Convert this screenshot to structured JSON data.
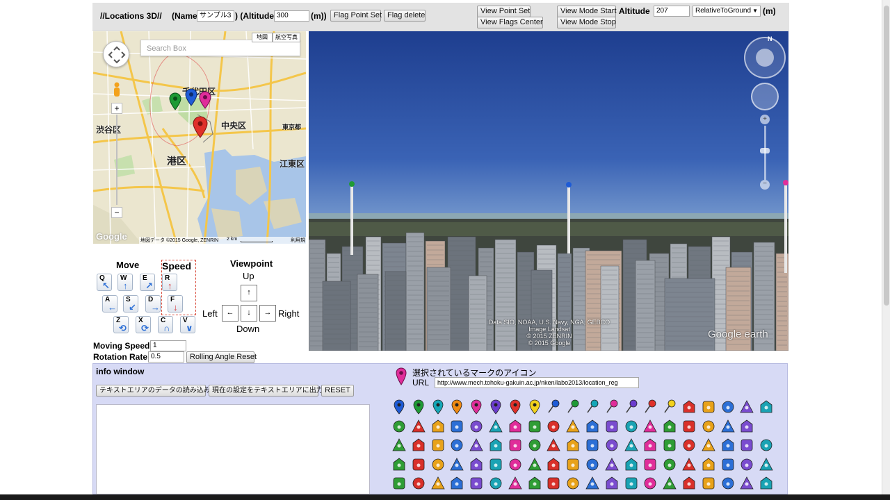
{
  "toolbar": {
    "title": "//Locations 3D//",
    "name_label": "(Name",
    "name_value": "サンプル3",
    "altitude_label": ") (Altitude",
    "altitude_value": "300",
    "altitude_unit": "(m))",
    "flag_point_set": "Flag Point Set",
    "flag_delete": "Flag delete",
    "view_point_set": "View Point Set",
    "view_flags_center": "View Flags Center",
    "view_mode_start": "View Mode Start",
    "view_mode_stop": "View Mode Stop",
    "altitude2_label": "Altitude",
    "altitude2_value": "207",
    "altitude_mode": "RelativeToGround",
    "altitude2_unit": "(m)"
  },
  "map": {
    "search_placeholder": "Search Box",
    "type_map": "地図",
    "type_satellite": "航空写真",
    "labels": [
      {
        "text": "千代田区"
      },
      {
        "text": "中央区"
      },
      {
        "text": "渋谷区"
      },
      {
        "text": "港区"
      },
      {
        "text": "江東区"
      },
      {
        "text": "東京都"
      }
    ],
    "footer_google": "Google",
    "footer_copyright": "地図データ ©2015 Google, ZENRIN",
    "footer_scale": "2 km",
    "footer_terms": "利用規約",
    "zoom_in": "+",
    "zoom_out": "−"
  },
  "globe": {
    "attribution_line1": "Data SIO, NOAA, U.S. Navy, NGA, GEBCO",
    "attribution_line2": "Image Landsat",
    "attribution_line3": "© 2015 ZENRIN",
    "attribution_line4": "© 2015 Google",
    "logo": "Google earth",
    "compass_n": "N"
  },
  "controls": {
    "move_title": "Move",
    "speed_title": "Speed",
    "viewpoint_title": "Viewpoint",
    "up": "Up",
    "down": "Down",
    "left": "Left",
    "right": "Right",
    "keys": [
      "Q",
      "W",
      "E",
      "R",
      "A",
      "S",
      "D",
      "F",
      "Z",
      "X",
      "C",
      "V"
    ],
    "vp_up": "↑",
    "vp_left": "←",
    "vp_down": "↓",
    "vp_right": "→"
  },
  "settings": {
    "moving_speed_label": "Moving Speed",
    "moving_speed_value": "1",
    "rotation_rate_label": "Rotation Rate",
    "rotation_rate_value": "0.5",
    "rolling_reset": "Rolling Angle Reset"
  },
  "info": {
    "title": "info window",
    "load_button": "テキストエリアのデータの読み込み",
    "output_button": "現在の設定をテキストエリアに出力",
    "reset_button": "RESET",
    "selected_icon_label": "選択されているマークのアイコン",
    "url_label": "URL",
    "url_value": "http://www.mech.tohoku-gakuin.ac.jp/nken/labo2013/location_reg"
  },
  "colors": {
    "pin_blue": "#1e5bd6",
    "pin_green": "#1f9a35",
    "pin_teal": "#15a7b8",
    "pin_orange": "#f08a12",
    "pin_magenta": "#e02d9a",
    "pin_purple": "#6b3ccd",
    "pin_red": "#e0302a",
    "pin_yellow": "#f2d11c",
    "info_bg": "#d7daf5",
    "toolbar_bg": "#e3e3e3"
  },
  "icon_names": [
    [
      "pin-blue-icon",
      "pin-green-icon",
      "pin-teal-icon",
      "pin-orange-icon",
      "pin-magenta-icon",
      "pin-purple-icon",
      "pin-red-icon",
      "pin-yellow-icon",
      "pushpin-blue-icon",
      "pushpin-green-icon",
      "pushpin-teal-icon",
      "pushpin-pink-icon",
      "pushpin-purple-icon",
      "pushpin-red-icon",
      "pushpin-yellow-icon",
      "theater-icon",
      "cocktail-icon",
      "bus-icon",
      "taxi-icon",
      "camera-icon"
    ],
    [
      "camping-icon",
      "caution-icon",
      "cafe-icon",
      "shopping-icon",
      "cycling-icon",
      "dollar-icon",
      "drinks-icon",
      "no-entry-icon",
      "tv-icon",
      "euro-icon",
      "factory-icon",
      "bell-icon",
      "fire-icon",
      "faucet-icon",
      "flag-icon",
      "golf-icon",
      "convenience-icon",
      "glider-icon",
      "home-icon"
    ],
    [
      "airplane-icon",
      "hospital-icon",
      "hotspring-icon",
      "lodging-icon",
      "hiking-icon",
      "tree-icon",
      "target-icon",
      "car-icon",
      "library-icon",
      "info-icon",
      "parking-icon",
      "laundry-icon",
      "mobile-icon",
      "motorcycle-icon",
      "monument-icon",
      "compass-icon",
      "snowflake-icon",
      "lighthouse-icon",
      "lookout-icon",
      "photo-icon"
    ],
    [
      "car-front-icon",
      "toilet-icon",
      "police-icon",
      "phone-icon",
      "arrow-down-icon",
      "train-icon",
      "info-i-icon",
      "question-icon",
      "map-icon",
      "bed-icon",
      "person-icon",
      "anchor-icon",
      "wrench-icon",
      "bike-icon",
      "paw-icon",
      "parking-p-icon",
      "sun-icon",
      "restaurant-icon",
      "telephone-icon",
      "picnic-icon"
    ],
    [
      "airport-icon",
      "airplane-arrow-icon",
      "baggage-icon",
      "post-office-icon",
      "mail-icon",
      "help-icon",
      "tram-icon",
      "sweets-icon",
      "toys-icon",
      "cutlery-icon",
      "sailing-icon",
      "bridge-icon",
      "shopping-bag-icon",
      "toilet-seat-icon",
      "star-icon",
      "fish-icon",
      "surfing-icon",
      "subway-icon",
      "sunrise-icon",
      "swimming-icon"
    ]
  ]
}
